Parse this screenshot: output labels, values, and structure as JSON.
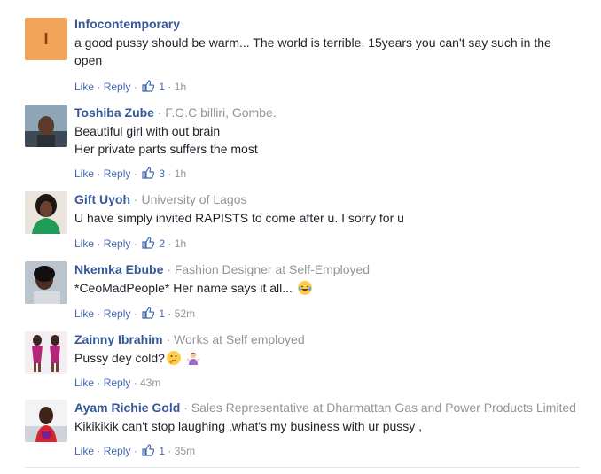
{
  "actions": {
    "like": "Like",
    "reply": "Reply",
    "dot": "·"
  },
  "colors": {
    "link": "#365899",
    "meta": "#90949c",
    "action": "#4267b2"
  },
  "comments": [
    {
      "author": "Infocontemporary",
      "affiliation": "",
      "avatar_letter": "I",
      "lines": [
        "a good pussy should be warm... The world is terrible, 15years you can't say such in the",
        "open"
      ],
      "likes": "1",
      "time": "1h"
    },
    {
      "author": "Toshiba Zube",
      "affiliation": "F.G.C billiri, Gombe.",
      "lines": [
        "Beautiful girl with out brain",
        "Her private parts suffers the most"
      ],
      "likes": "3",
      "time": "1h"
    },
    {
      "author": "Gift Uyoh",
      "affiliation": "University of Lagos",
      "lines": [
        "U have simply invited RAPISTS to come after u. I sorry for u"
      ],
      "likes": "2",
      "time": "1h"
    },
    {
      "author": "Nkemka Ebube",
      "affiliation": "Fashion Designer at Self-Employed",
      "lines": [
        "*CeoMadPeople* Her name says it all..."
      ],
      "emoji": "laughing-tears-emoji",
      "likes": "1",
      "time": "52m"
    },
    {
      "author": "Zainny Ibrahim",
      "affiliation": "Works at Self employed",
      "lines": [
        "Pussy dey cold?"
      ],
      "emoji": "thinking-face-emoji",
      "likes": "",
      "time": "43m"
    },
    {
      "author": "Ayam Richie Gold",
      "affiliation": "Sales Representative at Dharmattan Gas and Power Products Limited",
      "lines": [
        "Kikikikik can't stop laughing ,what's my business with ur pussy ,"
      ],
      "likes": "1",
      "time": "35m"
    }
  ]
}
